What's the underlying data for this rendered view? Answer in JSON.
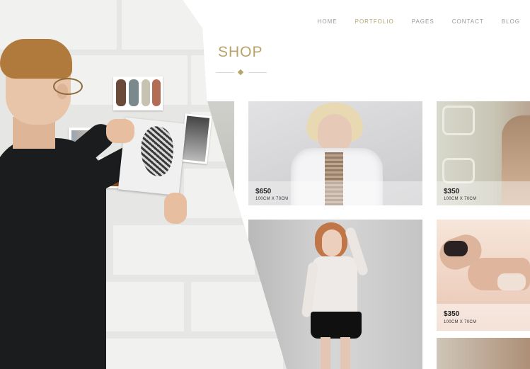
{
  "nav": {
    "items": [
      {
        "label": "HOME",
        "active": false
      },
      {
        "label": "PORTFOLIO",
        "active": true
      },
      {
        "label": "PAGES",
        "active": false
      },
      {
        "label": "CONTACT",
        "active": false
      },
      {
        "label": "BLOG",
        "active": false
      }
    ]
  },
  "page": {
    "title": "SHOP"
  },
  "products": [
    {
      "price": "$650",
      "size": "100CM X 70CM"
    },
    {
      "price": "$350",
      "size": "100CM X 70CM"
    },
    {
      "price": "$350",
      "size": "100CM X 70CM"
    }
  ],
  "colors": {
    "accent": "#b8a36a",
    "nav_text": "#9a9a9a",
    "background": "#ffffff"
  }
}
